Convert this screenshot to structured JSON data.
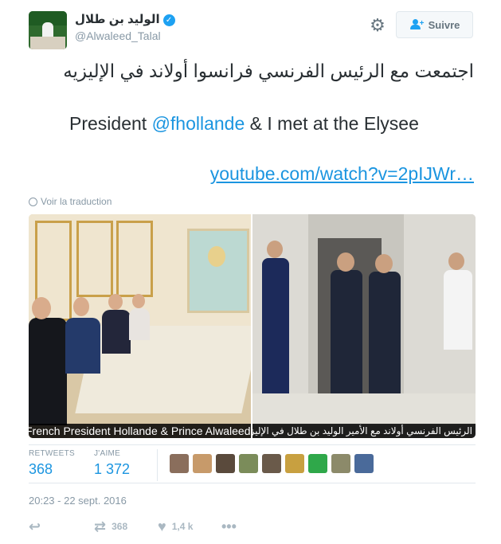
{
  "author": {
    "name": "الوليد بن طلال",
    "handle": "@Alwaleed_Talal"
  },
  "follow_label": "Suivre",
  "tweet": {
    "arabic": "اجتمعت مع الرئيس الفرنسي فرانسوا أولاند في الإليزيه",
    "english_before": "President ",
    "mention": "@fhollande",
    "english_after": " & I met at the Elysee",
    "link": "youtube.com/watch?v=2pIJWr…"
  },
  "translate_label": "Voir la traduction",
  "media": {
    "caption_left": "French President Hollande & Prince Alwaleed",
    "caption_right": "الرئيس الفرنسي أولاند مع الأمير الوليد بن طلال في الإليزيه"
  },
  "stats": {
    "retweets_label": "RETWEETS",
    "retweets": "368",
    "likes_label": "J'AIME",
    "likes": "1 372"
  },
  "liker_colors": [
    "#8a6e5c",
    "#c79a6a",
    "#5a4a3c",
    "#7b8c5a",
    "#6a5a4a",
    "#c8a040",
    "#2fa84a",
    "#8c8a6a",
    "#4a6a9a"
  ],
  "date": "20:23 - 22 sept. 2016",
  "actions": {
    "retweet_count": "368",
    "like_count": "1,4 k"
  },
  "colors": {
    "link": "#1b95e0",
    "muted": "#8899a6",
    "verified": "#1da1f2"
  }
}
